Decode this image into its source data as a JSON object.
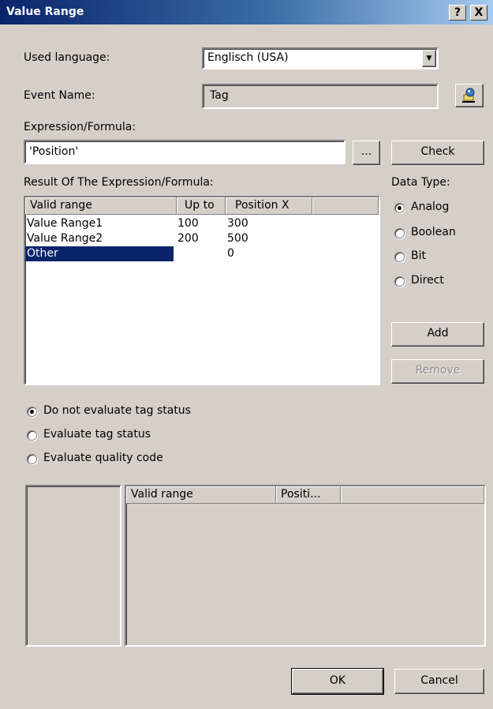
{
  "window": {
    "title": "Value Range",
    "help_glyph": "?",
    "close_glyph": "X"
  },
  "form": {
    "language_label": "Used language:",
    "language_value": "Englisch (USA)",
    "event_label": "Event Name:",
    "event_value": "Tag",
    "expression_label": "Expression/Formula:",
    "expression_value": "'Position'",
    "browse_label": "...",
    "check_label": "Check",
    "result_label": "Result Of The Expression/Formula:"
  },
  "result_table": {
    "columns": [
      "Valid range",
      "Up to",
      "Position X"
    ],
    "rows": [
      {
        "range": "Value Range1",
        "upto": "100",
        "posx": "300"
      },
      {
        "range": "Value Range2",
        "upto": "200",
        "posx": "500"
      },
      {
        "range": "Other",
        "upto": "",
        "posx": "0",
        "selected": true
      }
    ]
  },
  "data_type": {
    "label": "Data Type:",
    "options": [
      "Analog",
      "Boolean",
      "Bit",
      "Direct"
    ],
    "selected": "Analog"
  },
  "buttons": {
    "add": "Add",
    "remove": "Remove",
    "ok": "OK",
    "cancel": "Cancel"
  },
  "tag_status": {
    "options": [
      "Do not evaluate tag status",
      "Evaluate tag status",
      "Evaluate quality code"
    ],
    "selected": "Do not evaluate tag status"
  },
  "status_table": {
    "columns": [
      "Valid range",
      "Positi..."
    ]
  },
  "colors": {
    "selection": "#0a246a",
    "title_start": "#0a246a",
    "face": "#d4d0c8"
  }
}
